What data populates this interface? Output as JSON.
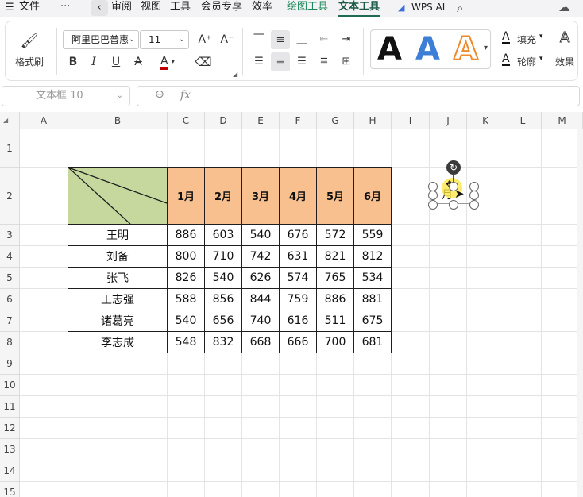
{
  "menubar": {
    "items": [
      "文件",
      "···",
      "审阅",
      "视图",
      "工具",
      "会员专享",
      "效率",
      "绘图工具",
      "文本工具",
      "WPS AI"
    ],
    "colors": {
      "drawing_tools": "#1a8a5a",
      "text_tools": "#1a5a46"
    }
  },
  "ribbon": {
    "format_painter": "格式刷",
    "font_name": "阿里巴巴普惠",
    "font_size": "11",
    "bold": "B",
    "italic": "I",
    "underline": "U",
    "strike": "ᵃ",
    "font_color": "A",
    "grow": "A⁺",
    "shrink": "A⁻",
    "fill": "填充",
    "outline": "轮廓",
    "effects": "效果",
    "style_letter": "A"
  },
  "formula": {
    "namebox": "文本框 10",
    "fx": "fx"
  },
  "sheet": {
    "columns": [
      "A",
      "B",
      "C",
      "D",
      "E",
      "F",
      "G",
      "H",
      "I",
      "J",
      "K",
      "L",
      "M"
    ],
    "rows": [
      "1",
      "2",
      "3",
      "4",
      "5",
      "6",
      "7",
      "8",
      "9",
      "10",
      "11",
      "12",
      "13",
      "14",
      "15"
    ],
    "table": {
      "months": [
        "1月",
        "2月",
        "3月",
        "4月",
        "5月",
        "6月"
      ],
      "data": [
        {
          "name": "王明",
          "values": [
            "886",
            "603",
            "540",
            "676",
            "572",
            "559"
          ]
        },
        {
          "name": "刘备",
          "values": [
            "800",
            "710",
            "742",
            "631",
            "821",
            "812"
          ]
        },
        {
          "name": "张飞",
          "values": [
            "826",
            "540",
            "626",
            "574",
            "765",
            "534"
          ]
        },
        {
          "name": "王志强",
          "values": [
            "588",
            "856",
            "844",
            "759",
            "886",
            "881"
          ]
        },
        {
          "name": "诸葛亮",
          "values": [
            "540",
            "656",
            "740",
            "616",
            "511",
            "675"
          ]
        },
        {
          "name": "李志成",
          "values": [
            "548",
            "832",
            "668",
            "666",
            "700",
            "681"
          ]
        }
      ],
      "colors": {
        "header_fill": "#f8bf8f",
        "diag_fill": "#c6d89e"
      }
    },
    "textbox": {
      "text": "月"
    }
  }
}
